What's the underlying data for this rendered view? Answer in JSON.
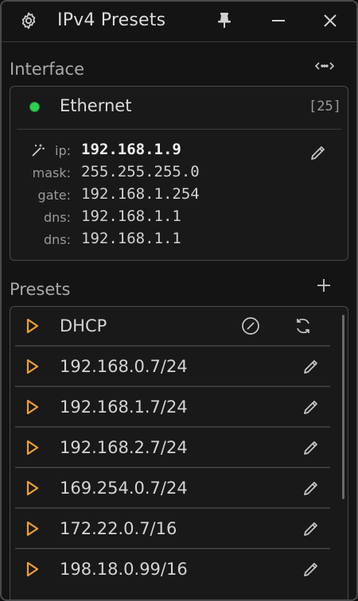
{
  "window": {
    "title": "IPv4 Presets",
    "icons": {
      "settings": "gear-icon",
      "pin": "pin-icon",
      "minimize": "minimize-icon",
      "close": "close-icon"
    }
  },
  "interface_section": {
    "label": "Interface",
    "toggle_icon": "expand-horizontal-icon",
    "adapter": {
      "name": "Ethernet",
      "index": "[25]",
      "status_color": "#2fd04e"
    },
    "fields": [
      {
        "label": "ip:",
        "value": "192.168.1.9"
      },
      {
        "label": "mask:",
        "value": "255.255.255.0"
      },
      {
        "label": "gate:",
        "value": "192.168.1.254"
      },
      {
        "label": "dns:",
        "value": "192.168.1.1"
      },
      {
        "label": "dns:",
        "value": "192.168.1.1"
      }
    ]
  },
  "presets_section": {
    "label": "Presets",
    "add_icon": "plus-icon",
    "items": [
      {
        "label": "DHCP"
      },
      {
        "label": "192.168.0.7/24"
      },
      {
        "label": "192.168.1.7/24"
      },
      {
        "label": "192.168.2.7/24"
      },
      {
        "label": "169.254.0.7/24"
      },
      {
        "label": "172.22.0.7/16"
      },
      {
        "label": "198.18.0.99/16"
      }
    ]
  },
  "colors": {
    "accent": "#f0a030",
    "background": "#141415",
    "border": "#4a4a4c"
  }
}
